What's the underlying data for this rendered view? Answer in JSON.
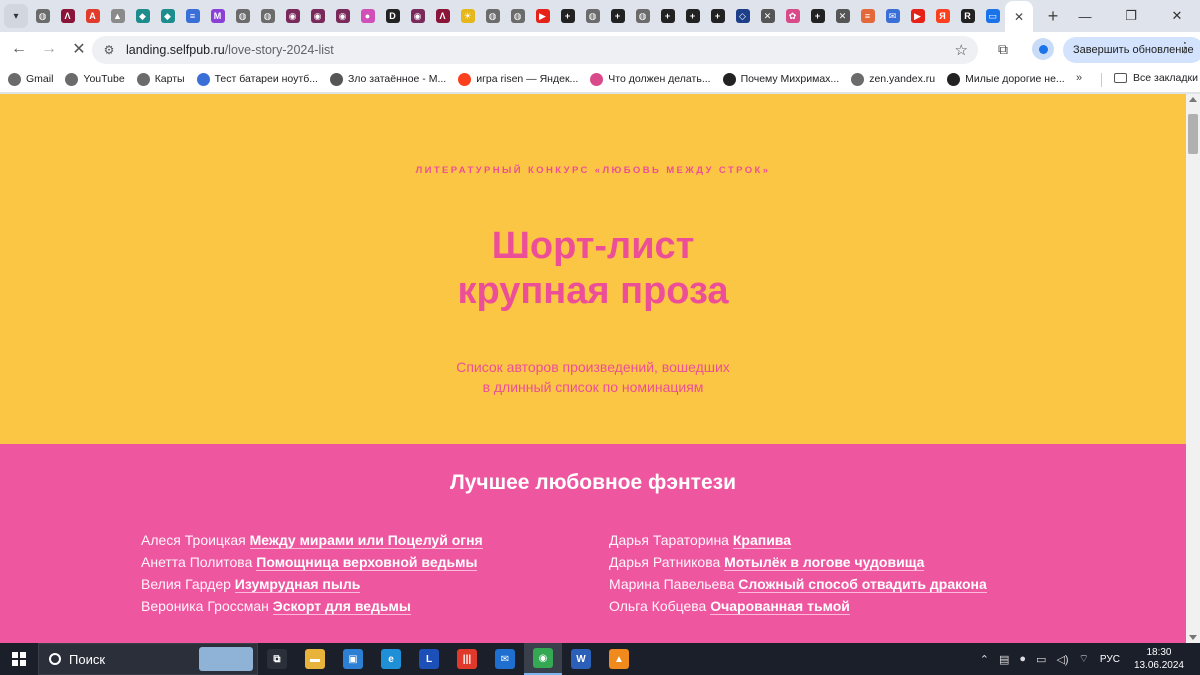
{
  "browser": {
    "tabs": [
      {
        "icon": "globe-icon",
        "color": "#6b6b6b",
        "glyph": "◍"
      },
      {
        "icon": "tab-red-square-icon",
        "color": "#8a1538",
        "glyph": "Λ"
      },
      {
        "icon": "tab-red-a-icon",
        "color": "#e03b2b",
        "glyph": "A"
      },
      {
        "icon": "tab-gray-icon",
        "color": "#8a8a8a",
        "glyph": "▲"
      },
      {
        "icon": "tab-teal-icon",
        "color": "#1c8c8c",
        "glyph": "◆"
      },
      {
        "icon": "tab-teal-icon",
        "color": "#1c8c8c",
        "glyph": "◆"
      },
      {
        "icon": "tab-blue-icon",
        "color": "#3b6fd8",
        "glyph": "≡"
      },
      {
        "icon": "tab-purple-m-icon",
        "color": "#8a3fd6",
        "glyph": "M"
      },
      {
        "icon": "globe-icon",
        "color": "#6b6b6b",
        "glyph": "◍"
      },
      {
        "icon": "globe-icon",
        "color": "#6b6b6b",
        "glyph": "◍"
      },
      {
        "icon": "tab-eye-icon",
        "color": "#7a2a5a",
        "glyph": "◉"
      },
      {
        "icon": "tab-eye-icon",
        "color": "#7a2a5a",
        "glyph": "◉"
      },
      {
        "icon": "tab-eye-icon",
        "color": "#7a2a5a",
        "glyph": "◉"
      },
      {
        "icon": "tab-dots-icon",
        "color": "#d04fb8",
        "glyph": "●"
      },
      {
        "icon": "tab-d-icon",
        "color": "#222222",
        "glyph": "D"
      },
      {
        "icon": "tab-eye-icon",
        "color": "#7a2a5a",
        "glyph": "◉"
      },
      {
        "icon": "tab-red-square-icon",
        "color": "#8a1538",
        "glyph": "Λ"
      },
      {
        "icon": "tab-sun-icon",
        "color": "#e6b71a",
        "glyph": "☀"
      },
      {
        "icon": "globe-icon",
        "color": "#6b6b6b",
        "glyph": "◍"
      },
      {
        "icon": "globe-icon",
        "color": "#6b6b6b",
        "glyph": "◍"
      },
      {
        "icon": "tab-youtube-icon",
        "color": "#e62117",
        "glyph": "▶"
      },
      {
        "icon": "tab-plus-icon",
        "color": "#222222",
        "glyph": "+"
      },
      {
        "icon": "globe-icon",
        "color": "#6b6b6b",
        "glyph": "◍"
      },
      {
        "icon": "tab-plus-icon",
        "color": "#222222",
        "glyph": "+"
      },
      {
        "icon": "globe-icon",
        "color": "#6b6b6b",
        "glyph": "◍"
      },
      {
        "icon": "tab-plus-icon",
        "color": "#222222",
        "glyph": "+"
      },
      {
        "icon": "tab-plus-icon",
        "color": "#222222",
        "glyph": "+"
      },
      {
        "icon": "tab-plus-icon",
        "color": "#222222",
        "glyph": "+"
      },
      {
        "icon": "tab-diamond-icon",
        "color": "#1d3f8a",
        "glyph": "◇"
      },
      {
        "icon": "tab-wing-icon",
        "color": "#555555",
        "glyph": "✕"
      },
      {
        "icon": "tab-pink-icon",
        "color": "#d84a8a",
        "glyph": "✿"
      },
      {
        "icon": "tab-plus-icon",
        "color": "#222222",
        "glyph": "+"
      },
      {
        "icon": "tab-wing-icon",
        "color": "#555555",
        "glyph": "✕"
      },
      {
        "icon": "tab-stripes-icon",
        "color": "#e3683a",
        "glyph": "≡"
      },
      {
        "icon": "tab-mail-icon",
        "color": "#3b6fd8",
        "glyph": "✉"
      },
      {
        "icon": "tab-youtube-icon",
        "color": "#e62117",
        "glyph": "▶"
      },
      {
        "icon": "tab-yandex-icon",
        "color": "#fc3f1d",
        "glyph": "Я"
      },
      {
        "icon": "tab-r-icon",
        "color": "#222222",
        "glyph": "R"
      },
      {
        "icon": "tab-chat-icon",
        "color": "#1a73e8",
        "glyph": "▭"
      }
    ],
    "active_tab_close": "✕",
    "new_tab": "+",
    "window": {
      "minimize": "—",
      "restore": "❐",
      "close": "✕"
    },
    "url_host": "landing.selfpub.ru",
    "url_path": "/love-story-2024-list",
    "update_button": "Завершить обновление",
    "bookmarks": [
      {
        "label": "Gmail",
        "icon": "gmail-icon",
        "color": "#6b6b6b"
      },
      {
        "label": "YouTube",
        "icon": "youtube-icon",
        "color": "#6b6b6b"
      },
      {
        "label": "Карты",
        "icon": "maps-icon",
        "color": "#6b6b6b"
      },
      {
        "label": "Тест батареи ноутб...",
        "icon": "battery-test-icon",
        "color": "#3b6fd8"
      },
      {
        "label": "Зло затаённое - М...",
        "icon": "wing-icon",
        "color": "#555555"
      },
      {
        "label": "игра risen — Яндек...",
        "icon": "yandex-icon",
        "color": "#fc3f1d"
      },
      {
        "label": "Что должен делать...",
        "icon": "flower-icon",
        "color": "#d84a8a"
      },
      {
        "label": "Почему Михримах...",
        "icon": "plus-square-icon",
        "color": "#222222"
      },
      {
        "label": "zen.yandex.ru",
        "icon": "globe-icon",
        "color": "#6b6b6b"
      },
      {
        "label": "Милые дорогие не...",
        "icon": "plus-square-icon",
        "color": "#222222"
      }
    ],
    "bookmarks_more": "»",
    "all_bookmarks": "Все закладки"
  },
  "page": {
    "kicker": "ЛИТЕРАТУРНЫЙ КОНКУРС «ЛЮБОВЬ МЕЖДУ СТРОК»",
    "title_line1": "Шорт-лист",
    "title_line2": "крупная проза",
    "subtitle_line1": "Список авторов произведений, вошедших",
    "subtitle_line2": "в длинный список по номинациям",
    "section_title": "Лучшее любовное фэнтези",
    "left_entries": [
      {
        "author": "Алеся Троицкая",
        "title": "Между мирами или Поцелуй огня"
      },
      {
        "author": "Анетта Политова",
        "title": "Помощница верховной ведьмы"
      },
      {
        "author": "Велия Гардер",
        "title": "Изумрудная пыль"
      },
      {
        "author": "Вероника Гроссман",
        "title": "Эскорт для ведьмы"
      }
    ],
    "right_entries": [
      {
        "author": "Дарья Тараторина",
        "title": "Крапива"
      },
      {
        "author": "Дарья Ратникова",
        "title": "Мотылёк в логове чудовища"
      },
      {
        "author": "Марина Павельева",
        "title": "Сложный способ отвадить дракона"
      },
      {
        "author": "Ольга Кобцева",
        "title": "Очарованная тьмой"
      }
    ],
    "colors": {
      "hero_bg": "#fcc645",
      "accent_pink": "#ec4f98",
      "section_bg": "#ef56a0"
    }
  },
  "taskbar": {
    "search_placeholder": "Поиск",
    "apps": [
      {
        "icon": "task-view-icon",
        "color": "#2b2f3a",
        "glyph": "⧉"
      },
      {
        "icon": "file-explorer-icon",
        "color": "#e8b33a",
        "glyph": "▬"
      },
      {
        "icon": "remote-desktop-icon",
        "color": "#2d7fd3",
        "glyph": "▣"
      },
      {
        "icon": "edge-icon",
        "color": "#1f8fd8",
        "glyph": "e"
      },
      {
        "icon": "l-app-icon",
        "color": "#1d4fb8",
        "glyph": "L"
      },
      {
        "icon": "red-app-icon",
        "color": "#e0392b",
        "glyph": "|||"
      },
      {
        "icon": "mail-icon",
        "color": "#1e6fd0",
        "glyph": "✉"
      },
      {
        "icon": "chrome-icon",
        "color": "#34a853",
        "glyph": "◉"
      },
      {
        "icon": "word-icon",
        "color": "#2b5fb8",
        "glyph": "W"
      },
      {
        "icon": "vlc-icon",
        "color": "#f08a1d",
        "glyph": "▲"
      }
    ],
    "tray_icons": [
      "⌃",
      "▤",
      "●",
      "▭",
      "◁)",
      "⌔"
    ],
    "language": "РУС",
    "time": "18:30",
    "date": "13.06.2024"
  }
}
